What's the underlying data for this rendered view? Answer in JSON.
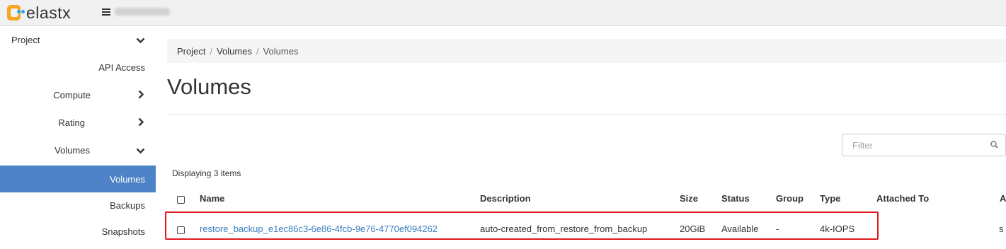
{
  "header": {
    "brand": "elastx"
  },
  "sidebar": {
    "items": [
      {
        "label": "Project",
        "chevron": "down"
      },
      {
        "label": "API Access"
      },
      {
        "label": "Compute",
        "chevron": "right"
      },
      {
        "label": "Rating",
        "chevron": "right"
      },
      {
        "label": "Volumes",
        "chevron": "down"
      },
      {
        "label": "Volumes",
        "active": true
      },
      {
        "label": "Backups"
      },
      {
        "label": "Snapshots"
      }
    ]
  },
  "breadcrumb": [
    "Project",
    "Volumes",
    "Volumes"
  ],
  "page": {
    "title": "Volumes"
  },
  "filter": {
    "placeholder": "Filter"
  },
  "table": {
    "count_text": "Displaying 3 items",
    "columns": [
      "Name",
      "Description",
      "Size",
      "Status",
      "Group",
      "Type",
      "Attached To",
      "A"
    ],
    "rows": [
      {
        "name": "restore_backup_e1ec86c3-6e86-4fcb-9e76-4770ef094262",
        "description": "auto-created_from_restore_from_backup",
        "size": "20GiB",
        "status": "Available",
        "group": "-",
        "type": "4k-IOPS",
        "attached_to": "",
        "extra": "s"
      }
    ]
  }
}
